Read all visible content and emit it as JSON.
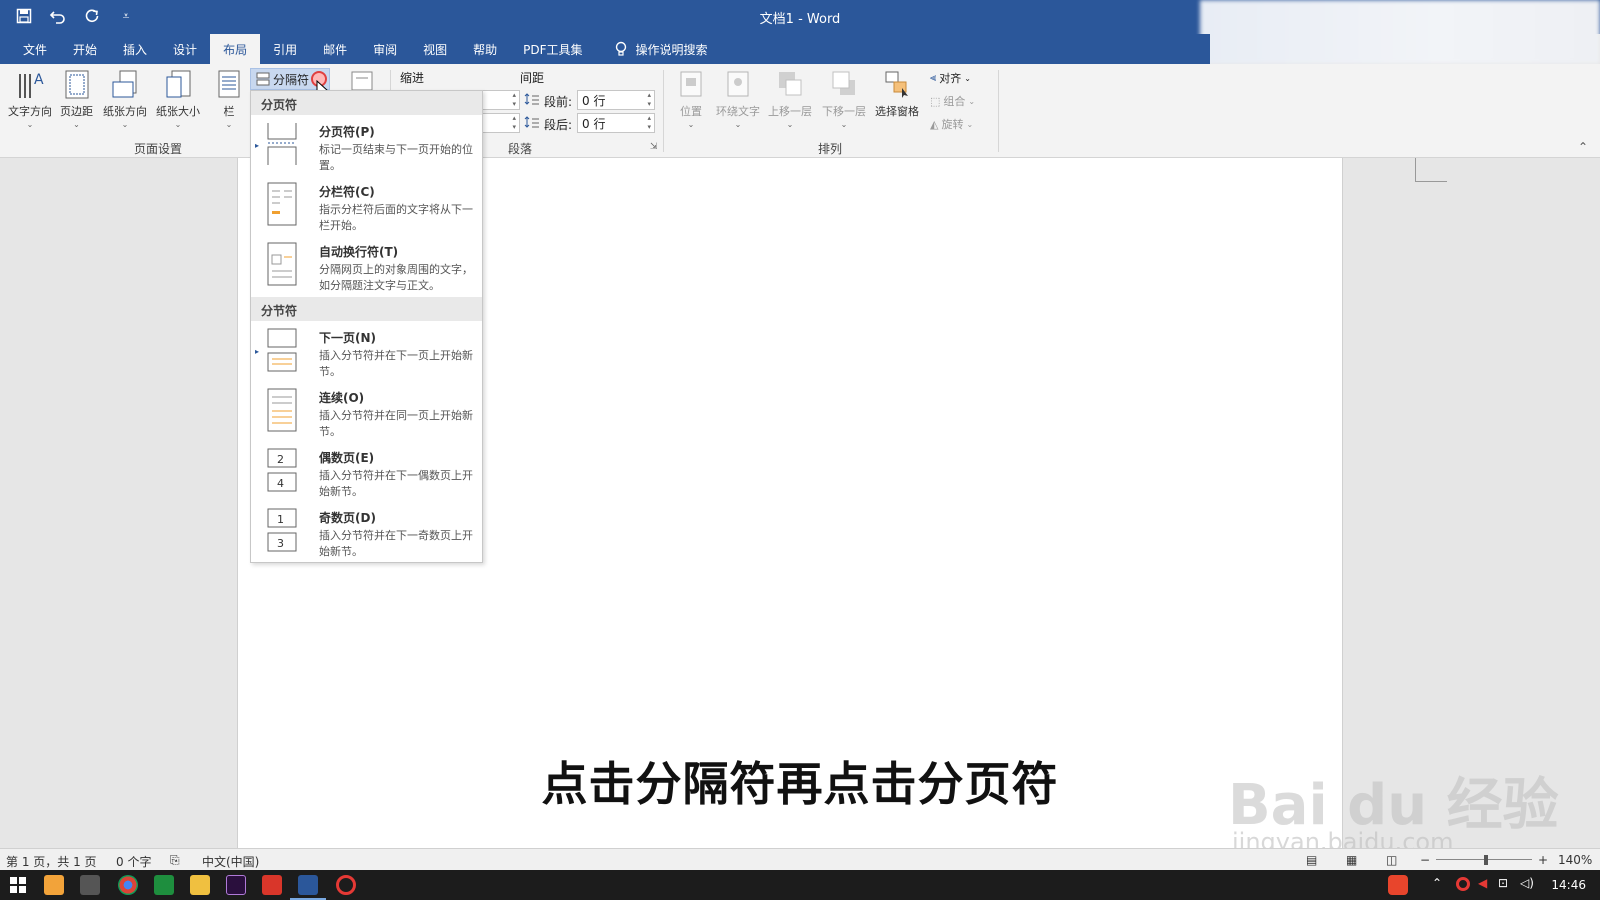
{
  "window": {
    "title": "文档1  -  Word"
  },
  "qat": {
    "save_icon": "save-icon",
    "undo_icon": "undo-icon",
    "redo_icon": "redo-icon",
    "customize_glyph": "⩡"
  },
  "tabs": [
    "文件",
    "开始",
    "插入",
    "设计",
    "布局",
    "引用",
    "邮件",
    "审阅",
    "视图",
    "帮助",
    "PDF工具集"
  ],
  "active_tab": "布局",
  "tell_me": "操作说明搜索",
  "ribbon": {
    "page_setup": {
      "label": "页面设置",
      "buttons": [
        "文字方向",
        "页边距",
        "纸张方向",
        "纸张大小",
        "栏"
      ]
    },
    "breaks_button": "分隔符",
    "indent_label": "缩进",
    "spacing_label": "间距",
    "spacing_before_label": "段前:",
    "spacing_before_value": "0 行",
    "spacing_after_label": "段后:",
    "spacing_after_value": "0 行",
    "paragraph_label": "段落",
    "arrange": {
      "label": "排列",
      "buttons": [
        "位置",
        "环绕文字",
        "上移一层",
        "下移一层",
        "选择窗格"
      ],
      "small": [
        "对齐",
        "组合",
        "旋转"
      ]
    }
  },
  "dropdown": {
    "page_breaks_header": "分页符",
    "section_breaks_header": "分节符",
    "page_items": [
      {
        "title": "分页符(P)",
        "desc": "标记一页结束与下一页开始的位置。"
      },
      {
        "title": "分栏符(C)",
        "desc": "指示分栏符后面的文字将从下一栏开始。"
      },
      {
        "title": "自动换行符(T)",
        "desc": "分隔网页上的对象周围的文字，如分隔题注文字与正文。"
      }
    ],
    "section_items": [
      {
        "title": "下一页(N)",
        "desc": "插入分节符并在下一页上开始新节。"
      },
      {
        "title": "连续(O)",
        "desc": "插入分节符并在同一页上开始新节。"
      },
      {
        "title": "偶数页(E)",
        "desc": "插入分节符并在下一偶数页上开始新节。"
      },
      {
        "title": "奇数页(D)",
        "desc": "插入分节符并在下一奇数页上开始新节。"
      }
    ]
  },
  "status": {
    "page": "第 1 页，共 1 页",
    "words": "0 个字",
    "language": "中文(中国)",
    "zoom": "140%"
  },
  "taskbar": {
    "time": "14:46"
  },
  "overlay": {
    "subtitle": "点击分隔符再点击分页符",
    "watermark_main": "Bai du 经验",
    "watermark_sub": "jingyan.baidu.com"
  },
  "colors": {
    "word_blue": "#2b579a",
    "ribbon_bg": "#f3f3f3",
    "highlight": "#c8d8ef"
  }
}
